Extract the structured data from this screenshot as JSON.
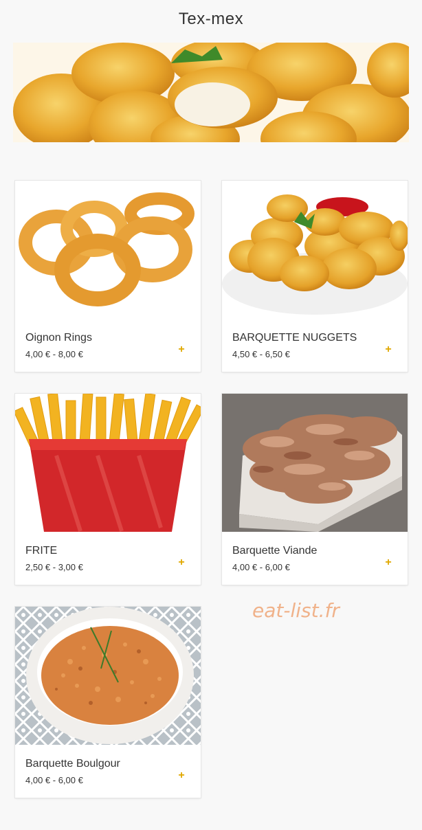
{
  "header": {
    "title": "Tex-mex"
  },
  "hero": {
    "image_name": "nuggets-hero-image"
  },
  "products": [
    {
      "name": "Oignon Rings",
      "price": "4,00 € - 8,00 €",
      "add_label": "+",
      "image": "onion-rings-image"
    },
    {
      "name": "BARQUETTE NUGGETS",
      "price": "4,50 € - 6,50 €",
      "add_label": "+",
      "image": "nuggets-image"
    },
    {
      "name": "FRITE",
      "price": "2,50 € - 3,00 €",
      "add_label": "+",
      "image": "fries-image"
    },
    {
      "name": "Barquette Viande",
      "price": "4,00 € - 6,00 €",
      "add_label": "+",
      "image": "meat-tray-image"
    },
    {
      "name": "Barquette Boulgour",
      "price": "4,00 € - 6,00 €",
      "add_label": "+",
      "image": "bulgur-bowl-image"
    }
  ],
  "watermark": {
    "text": "eat-list.fr"
  },
  "colors": {
    "accent": "#e0a800",
    "background": "#f8f8f8",
    "watermark": "#f0b28a"
  }
}
